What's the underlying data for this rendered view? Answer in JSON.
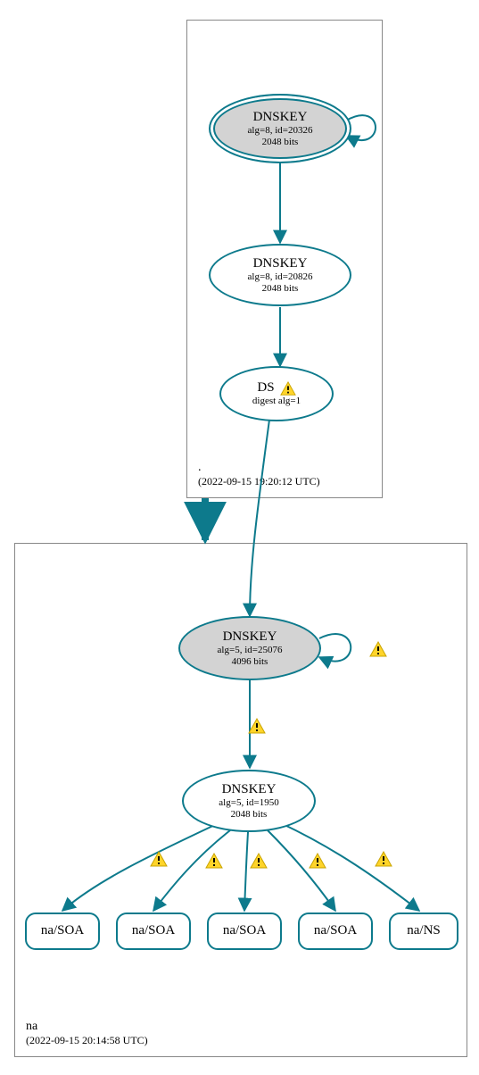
{
  "zones": {
    "root": {
      "name": ".",
      "timestamp": "(2022-09-15 19:20:12 UTC)"
    },
    "na": {
      "name": "na",
      "timestamp": "(2022-09-15 20:14:58 UTC)"
    }
  },
  "nodes": {
    "root_ksk": {
      "title": "DNSKEY",
      "line2": "alg=8, id=20326",
      "line3": "2048 bits"
    },
    "root_zsk": {
      "title": "DNSKEY",
      "line2": "alg=8, id=20826",
      "line3": "2048 bits"
    },
    "root_ds": {
      "title": "DS",
      "line2": "digest alg=1"
    },
    "na_ksk": {
      "title": "DNSKEY",
      "line2": "alg=5, id=25076",
      "line3": "4096 bits"
    },
    "na_zsk": {
      "title": "DNSKEY",
      "line2": "alg=5, id=1950",
      "line3": "2048 bits"
    },
    "rr1": {
      "label": "na/SOA"
    },
    "rr2": {
      "label": "na/SOA"
    },
    "rr3": {
      "label": "na/SOA"
    },
    "rr4": {
      "label": "na/SOA"
    },
    "rr5": {
      "label": "na/NS"
    }
  }
}
